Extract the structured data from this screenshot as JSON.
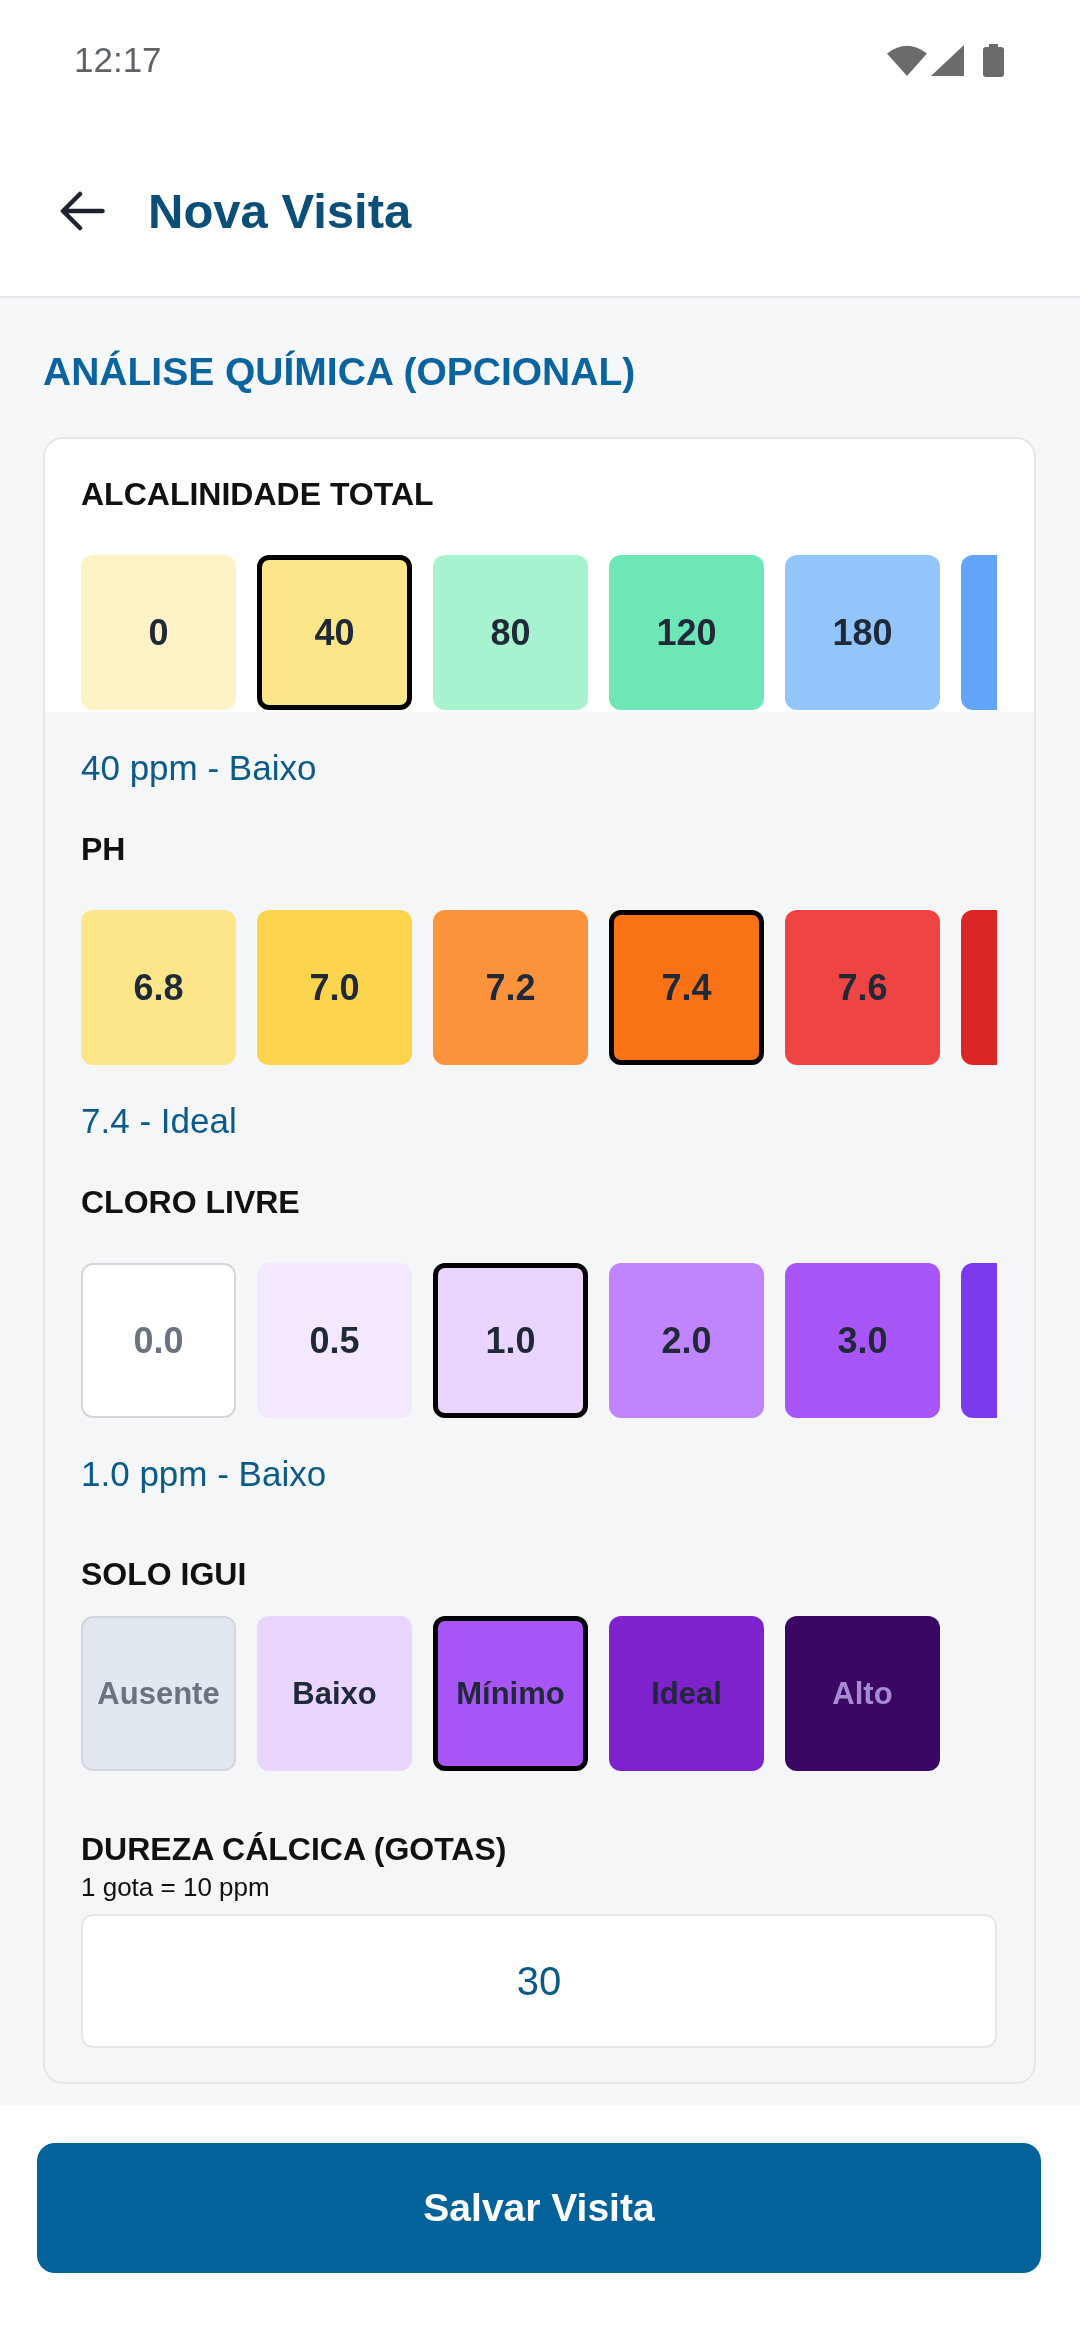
{
  "status_bar": {
    "time": "12:17"
  },
  "header": {
    "title": "Nova Visita"
  },
  "section": {
    "title": "ANÁLISE QUÍMICA (OPCIONAL)"
  },
  "parameters": [
    {
      "kind": "swatch",
      "label": "ALCALINIDADE TOTAL",
      "options": [
        {
          "kind": "fill",
          "label": "0",
          "color": "#fef3c7",
          "selected": false
        },
        {
          "kind": "fill",
          "label": "40",
          "color": "#fde68a",
          "selected": true
        },
        {
          "kind": "fill",
          "label": "80",
          "color": "#a7f3d0",
          "selected": false
        },
        {
          "kind": "fill",
          "label": "120",
          "color": "#6ee7b7",
          "selected": false
        },
        {
          "kind": "fill",
          "label": "180",
          "color": "#93c5fd",
          "selected": false
        },
        {
          "kind": "fill",
          "color": "#60a5fa",
          "selected": false
        }
      ],
      "status": "40 ppm - Baixo"
    },
    {
      "kind": "swatch",
      "label": "PH",
      "options": [
        {
          "kind": "fill",
          "label": "6.8",
          "color": "#fde68a",
          "selected": false
        },
        {
          "kind": "fill",
          "label": "7.0",
          "color": "#fcd34d",
          "selected": false
        },
        {
          "kind": "fill",
          "label": "7.2",
          "color": "#fb923c",
          "selected": false
        },
        {
          "kind": "fill",
          "label": "7.4",
          "color": "#f97316",
          "selected": true
        },
        {
          "kind": "fill",
          "label": "7.6",
          "color": "#ef4444",
          "selected": false
        },
        {
          "kind": "fill",
          "color": "#dc2626",
          "selected": false
        }
      ],
      "status": "7.4 - Ideal"
    },
    {
      "kind": "swatch",
      "label": "CLORO LIVRE",
      "options": [
        {
          "kind": "blank",
          "label": "0.0",
          "color": "#ffffff",
          "selected": false
        },
        {
          "kind": "fill",
          "label": "0.5",
          "color": "#f3e8ff",
          "selected": false
        },
        {
          "kind": "fill",
          "label": "1.0",
          "color": "#e9d5ff",
          "selected": true
        },
        {
          "kind": "fill",
          "label": "2.0",
          "color": "#c084fc",
          "selected": false
        },
        {
          "kind": "fill",
          "label": "3.0",
          "color": "#a855f7",
          "selected": false
        },
        {
          "kind": "fill",
          "color": "#7c3aed",
          "selected": false
        }
      ],
      "status": "1.0 ppm - Baixo"
    },
    {
      "kind": "level",
      "label": "SOLO IGUI",
      "options": [
        {
          "kind": "blank",
          "label": "Ausente",
          "color": "#e2e8f0",
          "selected": false
        },
        {
          "kind": "fill",
          "label": "Baixo",
          "color": "#e9d5ff",
          "selected": false
        },
        {
          "kind": "fill",
          "label": "Mínimo",
          "color": "#a855f7",
          "selected": true
        },
        {
          "kind": "fill",
          "label": "Ideal",
          "color": "#7e22ce",
          "selected": false
        },
        {
          "kind": "fill",
          "label": "Alto",
          "color": "#3b0764",
          "selected": false
        }
      ]
    }
  ],
  "hardness": {
    "label": "DUREZA CÁLCICA (GOTAS)",
    "hint": "1 gota = 10 ppm",
    "value": "30"
  },
  "save_button": {
    "label": "Salvar Visita"
  }
}
